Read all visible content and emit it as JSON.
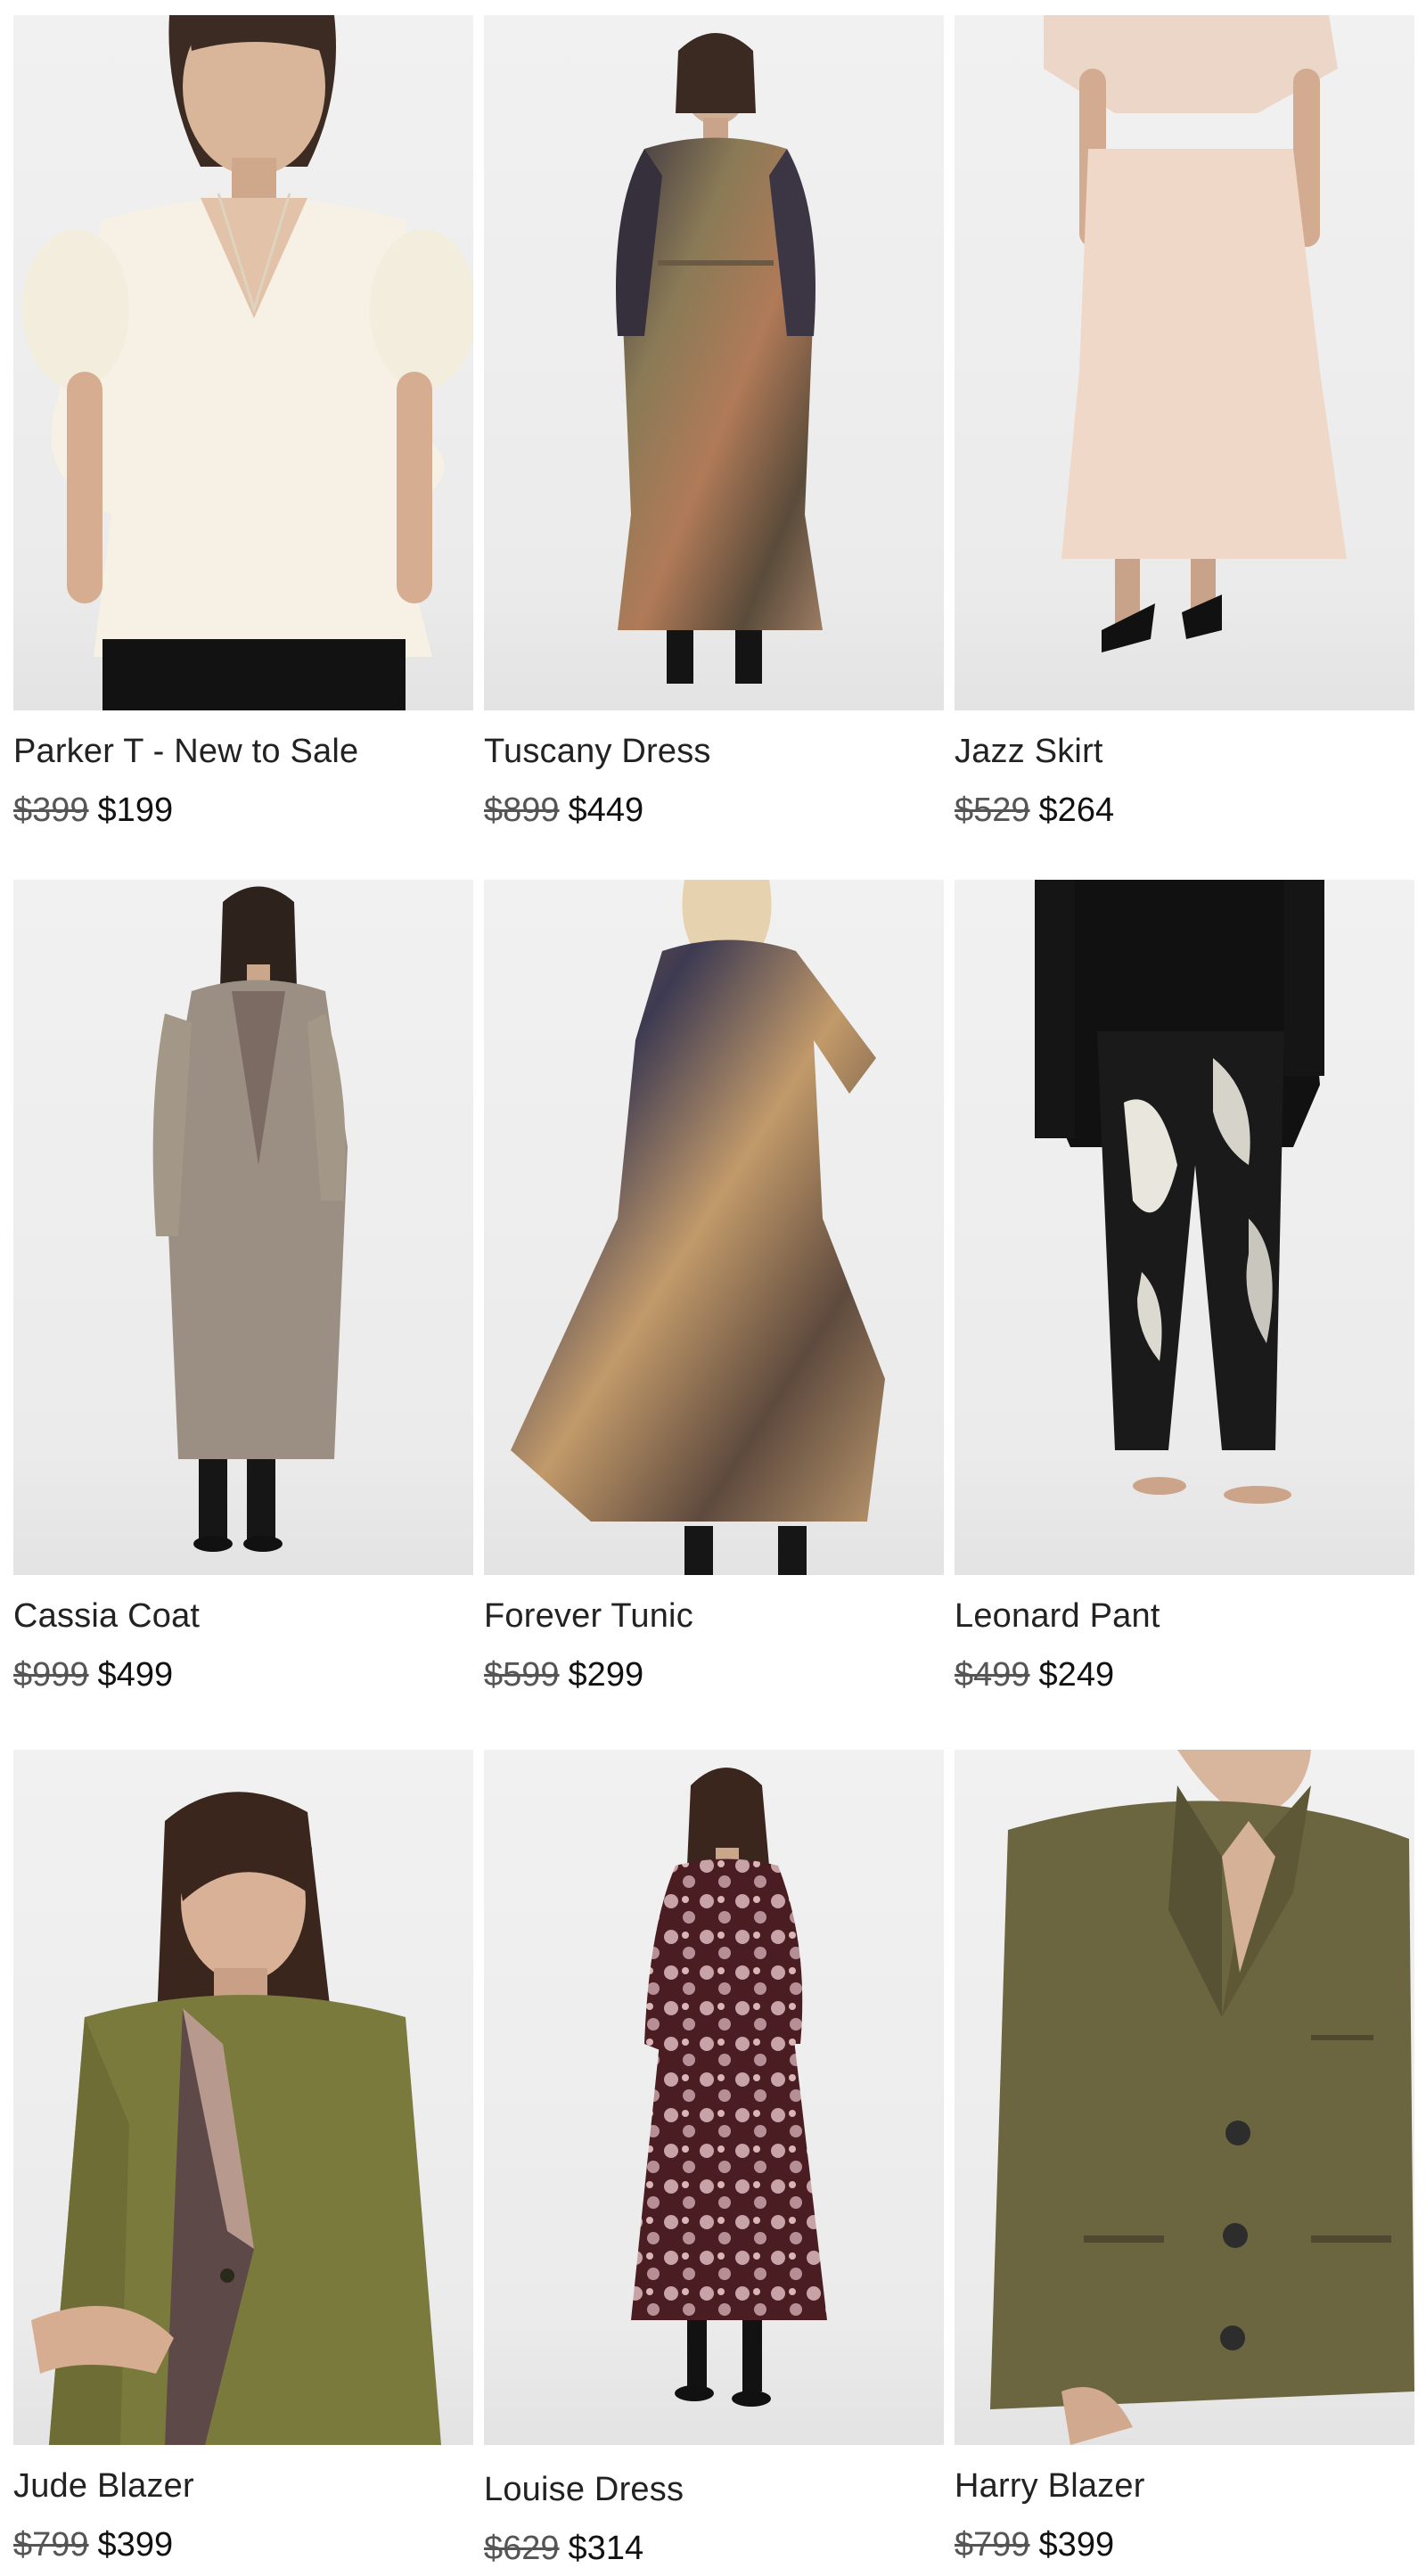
{
  "products": [
    {
      "name": "Parker T - New to Sale",
      "original_price": "$399",
      "sale_price": "$199",
      "image": "model-white-puff-sleeve-top"
    },
    {
      "name": "Tuscany Dress",
      "original_price": "$899",
      "sale_price": "$449",
      "image": "model-abstract-print-maxi-dress"
    },
    {
      "name": "Jazz Skirt",
      "original_price": "$529",
      "sale_price": "$264",
      "image": "model-blush-midi-skirt"
    },
    {
      "name": "Cassia Coat",
      "original_price": "$999",
      "sale_price": "$499",
      "image": "model-taupe-long-coat"
    },
    {
      "name": "Forever Tunic",
      "original_price": "$599",
      "sale_price": "$299",
      "image": "model-abstract-print-tiered-dress"
    },
    {
      "name": "Leonard Pant",
      "original_price": "$499",
      "sale_price": "$249",
      "image": "model-black-print-pant"
    },
    {
      "name": "Jude Blazer",
      "original_price": "$799",
      "sale_price": "$399",
      "image": "model-olive-blazer"
    },
    {
      "name": "Louise Dress",
      "original_price": "$629",
      "sale_price": "$314",
      "image": "model-burgundy-floral-dress"
    },
    {
      "name": "Harry Blazer",
      "original_price": "$799",
      "sale_price": "$399",
      "image": "model-khaki-tailored-blazer"
    }
  ],
  "colors": {
    "background": "#ffffff",
    "text": "#222222",
    "strikethrough_text": "#555555",
    "image_backdrop": "#ededed"
  }
}
